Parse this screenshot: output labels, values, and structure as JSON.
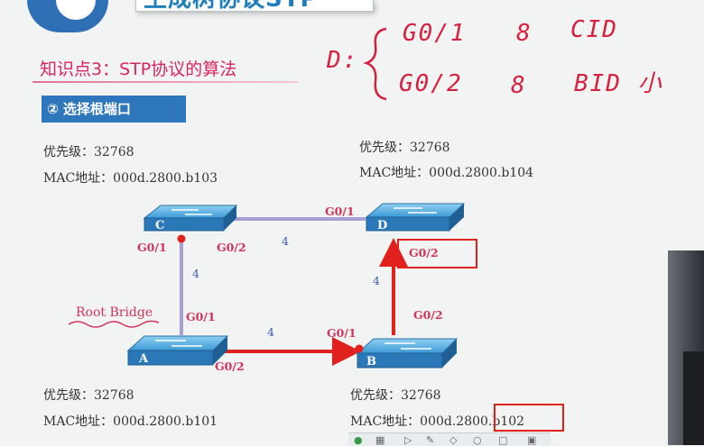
{
  "header": {
    "title": "生成树协议STP",
    "knowledge_point": "知识点3：STP协议的算法",
    "section": "② 选择根端口"
  },
  "handwriting": {
    "brace_label": "D:",
    "line1": {
      "port": "G0/1",
      "cost": "8",
      "note": "CID"
    },
    "line2": {
      "port": "G0/2",
      "cost": "8",
      "note": "BID 小"
    }
  },
  "switches": {
    "C": {
      "label": "C",
      "priority": "优先级：32768",
      "mac": "MAC地址：000d.2800.b103"
    },
    "D": {
      "label": "D",
      "priority": "优先级：32768",
      "mac": "MAC地址：000d.2800.b104"
    },
    "A": {
      "label": "A",
      "priority": "优先级：32768",
      "mac": "MAC地址：000d.2800.b101",
      "root_tag": "Root Bridge"
    },
    "B": {
      "label": "B",
      "priority": "优先级：32768",
      "mac": "MAC地址：000d.2800.b102"
    }
  },
  "ports": {
    "c_g01": "G0/1",
    "c_g02": "G0/2",
    "d_g01": "G0/1",
    "d_g02": "G0/2",
    "a_g01": "G0/1",
    "a_g02": "G0/2",
    "b_g01": "G0/1",
    "b_g02": "G0/2"
  },
  "costs": {
    "cd": "4",
    "ca": "4",
    "db": "4",
    "ab": "4"
  },
  "colors": {
    "accent_pink": "#d9245f",
    "section_blue": "#2f77bd",
    "path_red": "#e1211e",
    "link_purple": "#a99ed8"
  }
}
